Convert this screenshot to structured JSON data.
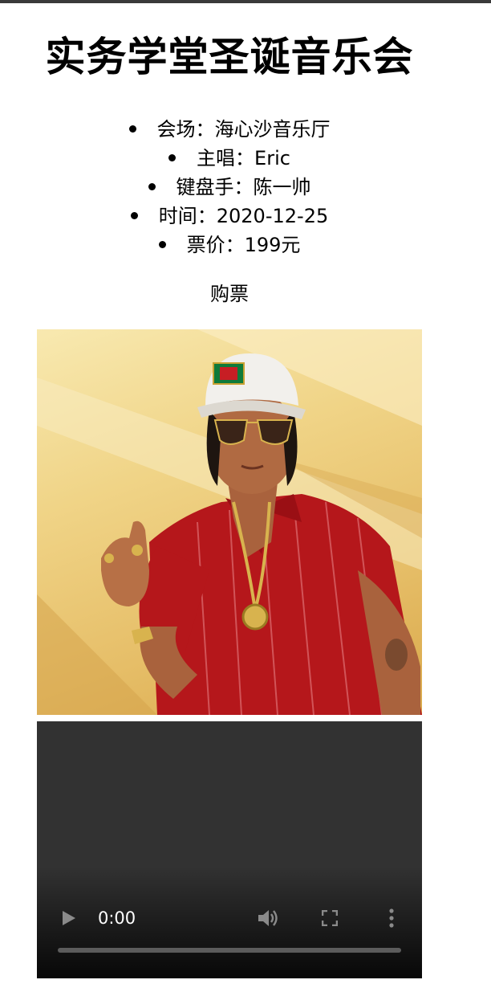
{
  "title": "实务学堂圣诞音乐会",
  "info": [
    {
      "label": "会场",
      "value": "海心沙音乐厅"
    },
    {
      "label": "主唱",
      "value": "Eric"
    },
    {
      "label": "键盘手",
      "value": "陈一帅"
    },
    {
      "label": "时间",
      "value": "2020-12-25"
    },
    {
      "label": "票价",
      "value": "199元"
    }
  ],
  "info_separator": "：",
  "buy_link": "购票",
  "video": {
    "current_time": "0:00",
    "icons": [
      "play-icon",
      "volume-icon",
      "fullscreen-icon",
      "more-vert-icon"
    ]
  },
  "colors": {
    "top_line": "#3a3a3a",
    "video_bg": "#323232",
    "poster_gold": "#f0d487",
    "shirt_red": "#b5171b"
  }
}
